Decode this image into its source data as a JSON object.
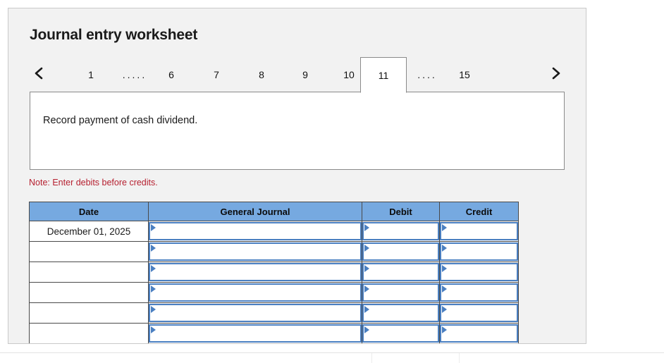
{
  "worksheet": {
    "title": "Journal entry worksheet",
    "instruction": "Record payment of cash dividend.",
    "note": "Note: Enter debits before credits."
  },
  "tabs": {
    "prev_icon": "chevron-left-icon",
    "next_icon": "chevron-right-icon",
    "prev_label": "‹",
    "next_label": "›",
    "active_index": 11,
    "items": [
      {
        "type": "tab",
        "label": "1",
        "active": false
      },
      {
        "type": "dots",
        "label": ".....",
        "active": false
      },
      {
        "type": "tab",
        "label": "6",
        "active": false
      },
      {
        "type": "tab",
        "label": "7",
        "active": false
      },
      {
        "type": "tab",
        "label": "8",
        "active": false
      },
      {
        "type": "tab",
        "label": "9",
        "active": false
      },
      {
        "type": "tab",
        "label": "10",
        "active": false
      },
      {
        "type": "tab",
        "label": "11",
        "active": true
      },
      {
        "type": "dots",
        "label": "....",
        "active": false
      },
      {
        "type": "tab",
        "label": "15",
        "active": false
      }
    ]
  },
  "table": {
    "headers": [
      "Date",
      "General Journal",
      "Debit",
      "Credit"
    ],
    "rows": [
      {
        "date": "December 01, 2025",
        "journal": "",
        "debit": "",
        "credit": ""
      },
      {
        "date": "",
        "journal": "",
        "debit": "",
        "credit": ""
      },
      {
        "date": "",
        "journal": "",
        "debit": "",
        "credit": ""
      },
      {
        "date": "",
        "journal": "",
        "debit": "",
        "credit": ""
      },
      {
        "date": "",
        "journal": "",
        "debit": "",
        "credit": ""
      },
      {
        "date": "",
        "journal": "",
        "debit": "",
        "credit": ""
      }
    ]
  },
  "colors": {
    "header_blue": "#76a9e0",
    "field_blue": "#4a7fc1",
    "note_red": "#b62030",
    "panel_grey": "#f2f2f2"
  }
}
